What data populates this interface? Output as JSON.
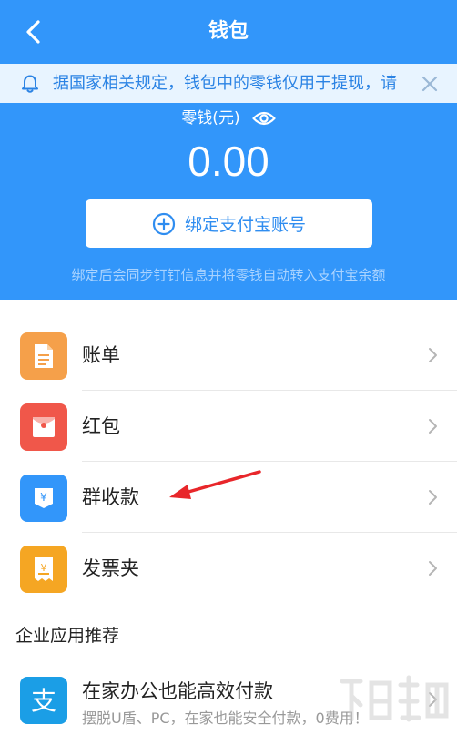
{
  "header": {
    "title": "钱包"
  },
  "notice": {
    "text": "据国家相关规定，钱包中的零钱仅用于提现，请"
  },
  "balance": {
    "label": "零钱(元)",
    "amount": "0.00"
  },
  "bind_button": {
    "label": "绑定支付宝账号"
  },
  "sync_note": "绑定后会同步钉钉信息并将零钱自动转入支付宝余额",
  "menu": [
    {
      "label": "账单",
      "icon": "bill-icon",
      "color": "#f5a04a"
    },
    {
      "label": "红包",
      "icon": "red-packet-icon",
      "color": "#f0574a"
    },
    {
      "label": "群收款",
      "icon": "group-collect-icon",
      "color": "#3296fa"
    },
    {
      "label": "发票夹",
      "icon": "invoice-icon",
      "color": "#f5a623"
    }
  ],
  "section_title": "企业应用推荐",
  "promo": {
    "title": "在家办公也能高效付款",
    "desc": "摆脱U盾、PC，在家也能安全付款，0费用！",
    "icon": "alipay-icon",
    "color": "#1b9ee6"
  },
  "colors": {
    "brand_blue": "#3296fa",
    "notice_bg": "#e8f4ff",
    "annotation_red": "#e8262a"
  }
}
